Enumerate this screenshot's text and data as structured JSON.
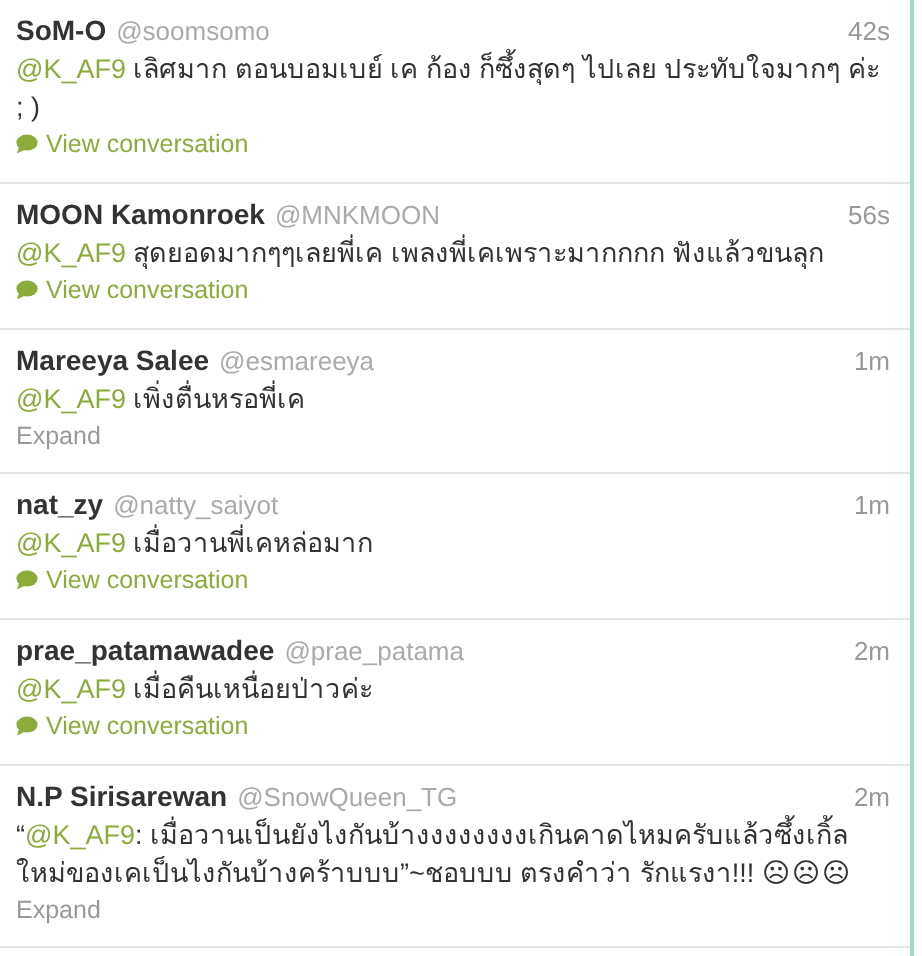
{
  "tweets": [
    {
      "name": "SoM-O",
      "handle": "@soomsomo",
      "time": "42s",
      "text": [
        {
          "kind": "mention",
          "text": "@K_AF9"
        },
        {
          "kind": "plain",
          "text": " เลิศมาก ตอนบอมเบย์ เค ก้อง ก็ซึ้งสุดๆ ไปเลย ประทับใจมากๆ ค่ะ ; )"
        }
      ],
      "action": {
        "kind": "conversation",
        "label": "View conversation"
      }
    },
    {
      "name": "MOON Kamonroek",
      "handle": "@MNKMOON",
      "time": "56s",
      "text": [
        {
          "kind": "mention",
          "text": "@K_AF9"
        },
        {
          "kind": "plain",
          "text": " สุดยอดมากๆๆเลยพี่เค เพลงพี่เคเพราะมากกกก ฟังแล้วขนลุก"
        }
      ],
      "action": {
        "kind": "conversation",
        "label": "View conversation"
      }
    },
    {
      "name": "Mareeya Salee",
      "handle": "@esmareeya",
      "time": "1m",
      "text": [
        {
          "kind": "mention",
          "text": "@K_AF9"
        },
        {
          "kind": "plain",
          "text": " เพิ่งตื่นหรอพี่เค"
        }
      ],
      "action": {
        "kind": "expand",
        "label": "Expand"
      }
    },
    {
      "name": "nat_zy",
      "handle": "@natty_saiyot",
      "time": "1m",
      "text": [
        {
          "kind": "mention",
          "text": "@K_AF9"
        },
        {
          "kind": "plain",
          "text": " เมื่อวานพี่เคหล่อมาก"
        }
      ],
      "action": {
        "kind": "conversation",
        "label": "View conversation"
      }
    },
    {
      "name": "prae_patamawadee",
      "handle": "@prae_patama",
      "time": "2m",
      "text": [
        {
          "kind": "mention",
          "text": "@K_AF9"
        },
        {
          "kind": "plain",
          "text": " เมื่อคืนเหนื่อยป่าวค่ะ"
        }
      ],
      "action": {
        "kind": "conversation",
        "label": "View conversation"
      }
    },
    {
      "name": "N.P Sirisarewan",
      "handle": "@SnowQueen_TG",
      "time": "2m",
      "text": [
        {
          "kind": "plain",
          "text": "“"
        },
        {
          "kind": "mention",
          "text": "@K_AF9"
        },
        {
          "kind": "plain",
          "text": ": เมื่อวานเป็นยังไงกันบ้างงงงงงงงเกินคาดไหมครับแล้วซึ้งเกิ้ลใหม่ของเคเป็นไงกันบ้างคร้าบบบ”~ชอบบบ ตรงคำว่า รักแรงา!!! ☹☹☹"
        }
      ],
      "action": {
        "kind": "expand",
        "label": "Expand"
      }
    }
  ]
}
